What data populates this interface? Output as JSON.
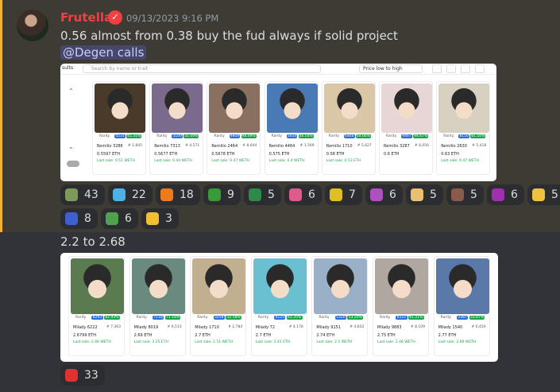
{
  "message1": {
    "username": "Frutella",
    "timestamp": "09/13/2023 9:16 PM",
    "text": "0.56 almost from 0.38 buy the fud always if solid project",
    "mention": "@Degen calls",
    "image": {
      "left_label": "sults",
      "search_placeholder": "Search by name or trait",
      "sort_label": "Price low to high",
      "cards": [
        {
          "name": "Remilio 3286",
          "num": "# 1,845",
          "rank": "4531",
          "pct": "45.31%",
          "price": "0.5597 ETH",
          "last": "Last sale: 0.51 WETH",
          "bg": "#4a3a2a"
        },
        {
          "name": "Remilio 7313",
          "num": "# 4,571",
          "rank": "3109",
          "pct": "31.09%",
          "price": "0.5677 ETH",
          "last": "Last sale: 0.44 WETH",
          "bg": "#7a6a8c"
        },
        {
          "name": "Remilio 2464",
          "num": "# 8,644",
          "rank": "9809",
          "pct": "98.09%",
          "price": "0.5678 ETH",
          "last": "Last sale: 0.47 WETH",
          "bg": "#8a7060"
        },
        {
          "name": "Remilio 4464",
          "num": "# 1,569",
          "rank": "3654",
          "pct": "36.54%",
          "price": "0.575 ETH",
          "last": "Last sale: 0.4 WETH",
          "bg": "#4a7ab5"
        },
        {
          "name": "Remilio 1710",
          "num": "# 5,627",
          "rank": "6466",
          "pct": "64.66%",
          "price": "0.58 ETH",
          "last": "Last sale: 0.53 ETH",
          "bg": "#d9c7a8"
        },
        {
          "name": "Remilio 3287",
          "num": "# 8,056",
          "rank": "9467",
          "pct": "94.67%",
          "price": "0.6 ETH",
          "last": "",
          "bg": "#e8d5d5"
        },
        {
          "name": "Remilio 2630",
          "num": "# 5,418",
          "rank": "8150",
          "pct": "81.50%",
          "price": "0.63 ETH",
          "last": "Last sale: 0.47 WETH",
          "bg": "#d8d0c0"
        }
      ]
    },
    "reactions": [
      {
        "icon": "frog-emoji-icon",
        "count": "43",
        "color": "#7d9a5a"
      },
      {
        "icon": "cat-emoji-icon",
        "count": "22",
        "color": "#4ab4e8"
      },
      {
        "icon": "fire-emoji-icon",
        "count": "18",
        "color": "#f07a1a"
      },
      {
        "icon": "dragon-emoji-icon",
        "count": "9",
        "color": "#3a9a3a"
      },
      {
        "icon": "lizard-emoji-icon",
        "count": "5",
        "color": "#2f8a4a"
      },
      {
        "icon": "octopus-emoji-icon",
        "count": "6",
        "color": "#e05a8a"
      },
      {
        "icon": "pepe-emoji-icon",
        "count": "7",
        "color": "#e0c020"
      },
      {
        "icon": "blob-emoji-icon",
        "count": "6",
        "color": "#b050c0"
      },
      {
        "icon": "face-emoji-icon",
        "count": "5",
        "color": "#e8c070"
      },
      {
        "icon": "pixel-emoji-icon",
        "count": "5",
        "color": "#8a5a4a"
      },
      {
        "icon": "ghost-emoji-icon",
        "count": "6",
        "color": "#a030b0"
      },
      {
        "icon": "hand-emoji-icon",
        "count": "5",
        "color": "#f0c040"
      },
      {
        "icon": "glitch-emoji-icon",
        "count": "8",
        "color": "#4060d0"
      },
      {
        "icon": "green-frog-emoji-icon",
        "count": "6",
        "color": "#50a050"
      },
      {
        "icon": "yellow-heart-emoji-icon",
        "count": "3",
        "color": "#f0c030"
      }
    ]
  },
  "message2": {
    "text": "2.2 to 2.68",
    "image": {
      "cards": [
        {
          "name": "Milady 6222",
          "num": "# 7,363",
          "rank": "8293",
          "pct": "82.93%",
          "price": "2.6799 ETH",
          "last": "Last sale: 2.46 WETH",
          "bg": "#5a7a50"
        },
        {
          "name": "Milady 8019",
          "num": "# 6,513",
          "rank": "7118",
          "pct": "71.18%",
          "price": "2.69 ETH",
          "last": "Last sale: 2.25 ETH",
          "bg": "#6a8a80"
        },
        {
          "name": "Milady 1710",
          "num": "# 2,784",
          "rank": "3258",
          "pct": "32.58%",
          "price": "2.7 ETH",
          "last": "Last sale: 2.51 WETH",
          "bg": "#c0b090"
        },
        {
          "name": "Milady 72",
          "num": "# 4,178",
          "rank": "4125",
          "pct": "41.25%",
          "price": "2.7 ETH",
          "last": "Last sale: 2.41 ETH",
          "bg": "#6ac0d0"
        },
        {
          "name": "Milady 9151",
          "num": "# 4,832",
          "rank": "5320",
          "pct": "53.20%",
          "price": "2.74 ETH",
          "last": "Last sale: 2.1 WETH",
          "bg": "#9ab0c8"
        },
        {
          "name": "Milady 9883",
          "num": "# 8,109",
          "rank": "6121",
          "pct": "61.21%",
          "price": "2.75 ETH",
          "last": "Last sale: 2.48 WETH",
          "bg": "#b0a8a0"
        },
        {
          "name": "Milady 1540",
          "num": "# 6,450",
          "rank": "3387",
          "pct": "33.87%",
          "price": "2.77 ETH",
          "last": "Last sale: 2.89 WETH",
          "bg": "#5a78a8"
        }
      ]
    },
    "reactions": [
      {
        "icon": "hundred-emoji-icon",
        "count": "33",
        "color": "#e03030"
      }
    ]
  }
}
